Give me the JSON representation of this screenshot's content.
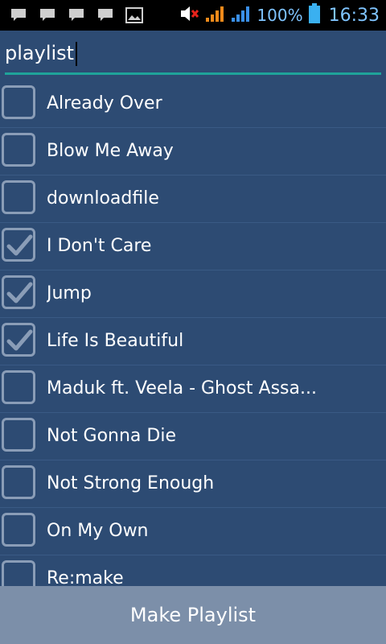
{
  "status_bar": {
    "notifications": [
      "chat-icon",
      "chat-icon",
      "chat-icon",
      "chat-icon",
      "image-icon"
    ],
    "battery_percent": "100%",
    "time": "16:33"
  },
  "search": {
    "value": "playlist",
    "placeholder": ""
  },
  "songs": [
    {
      "title": "Already Over",
      "checked": false
    },
    {
      "title": "Blow Me Away",
      "checked": false
    },
    {
      "title": "downloadfile",
      "checked": false
    },
    {
      "title": "I Don't Care",
      "checked": true
    },
    {
      "title": "Jump",
      "checked": true
    },
    {
      "title": "Life Is Beautiful",
      "checked": true
    },
    {
      "title": "Maduk ft. Veela - Ghost Assa...",
      "checked": false
    },
    {
      "title": "Not Gonna Die",
      "checked": false
    },
    {
      "title": "Not Strong Enough",
      "checked": false
    },
    {
      "title": "On My Own",
      "checked": false
    },
    {
      "title": "Re:make",
      "checked": false
    }
  ],
  "make_playlist_label": "Make Playlist",
  "colors": {
    "background": "#2d4b73",
    "accent": "#1fa39a",
    "button": "#7c8fa9",
    "status_text": "#7fc4ff"
  }
}
